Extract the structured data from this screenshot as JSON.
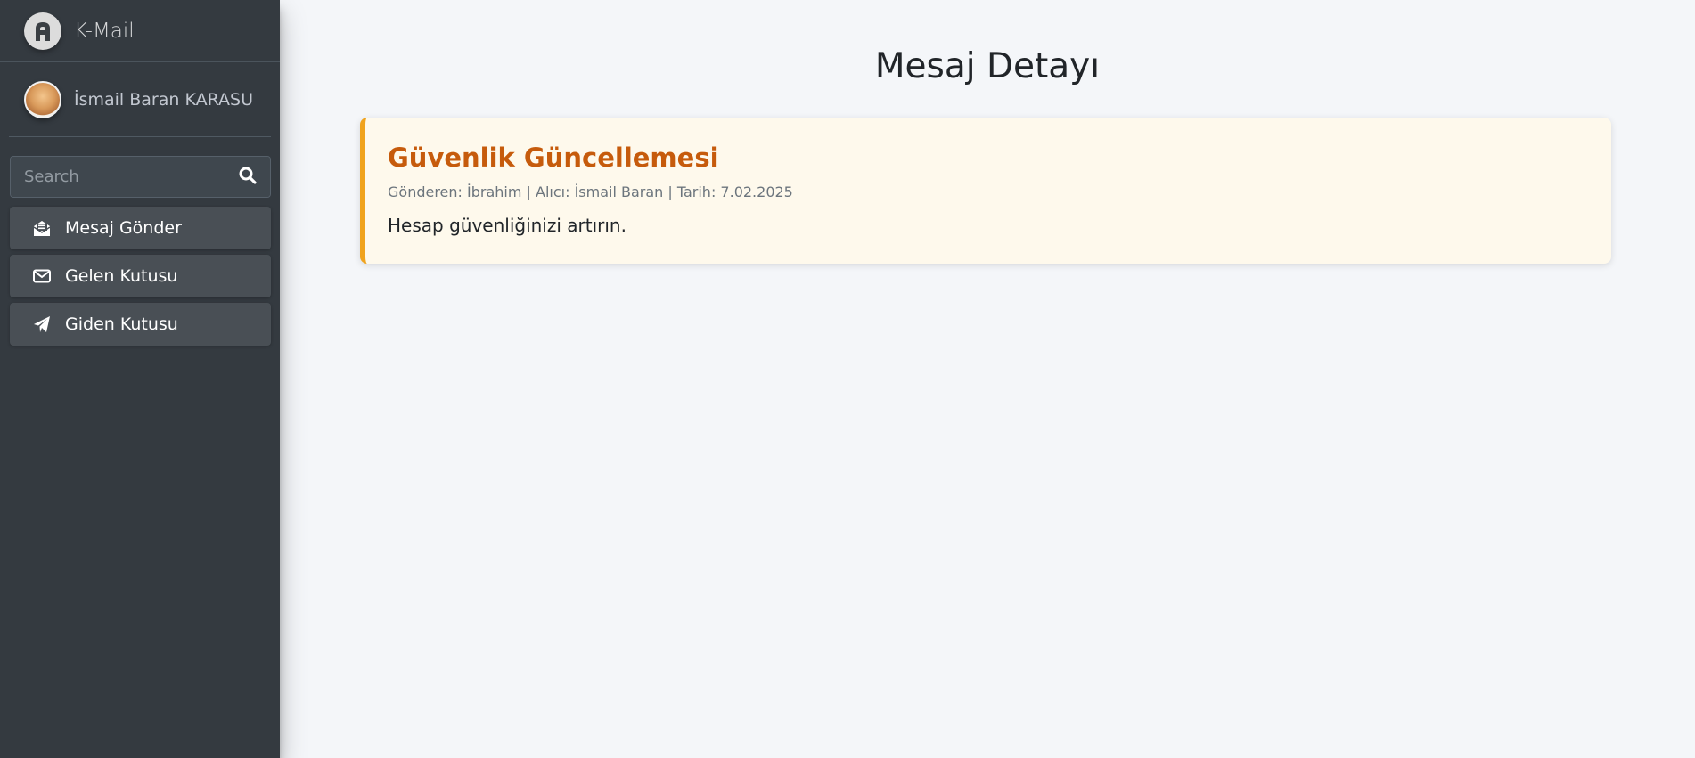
{
  "brand": {
    "name": "K-Mail"
  },
  "user": {
    "name": "İsmail Baran KARASU"
  },
  "search": {
    "placeholder": "Search"
  },
  "nav": {
    "items": [
      {
        "label": "Mesaj Gönder",
        "icon": "envelope-open-text-icon"
      },
      {
        "label": "Gelen Kutusu",
        "icon": "envelope-icon"
      },
      {
        "label": "Giden Kutusu",
        "icon": "paper-plane-icon"
      }
    ]
  },
  "page": {
    "title": "Mesaj Detayı"
  },
  "message": {
    "subject": "Güvenlik Güncellemesi",
    "meta": "Gönderen: İbrahim | Alıcı: İsmail Baran | Tarih: 7.02.2025",
    "body": "Hesap güvenliğinizi artırın."
  },
  "colors": {
    "sidebar_bg": "#343a40",
    "accent_border": "#f0a31d",
    "subject_color": "#c65b0c",
    "card_bg": "#fef9ec",
    "main_bg": "#f4f6f9"
  }
}
